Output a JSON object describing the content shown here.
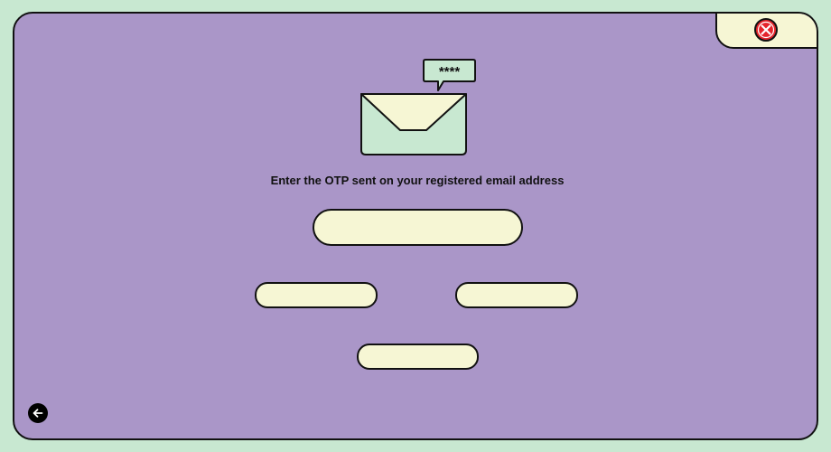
{
  "prompt": {
    "text": "Enter the OTP sent on your registered email address"
  },
  "otp_input": {
    "value": "",
    "placeholder": ""
  },
  "buttons": {
    "left_label": "",
    "right_label": "",
    "bottom_label": ""
  },
  "speech_bubble": {
    "text": "****"
  },
  "icons": {
    "close": "close-icon",
    "back": "back-arrow-icon",
    "envelope": "envelope-icon"
  },
  "colors": {
    "outer_background": "#c8e8d1",
    "panel_background": "#aa96c8",
    "field_fill": "#f6f6d4",
    "close_red": "#e5242b",
    "envelope_body": "#c8e8d1",
    "envelope_flap": "#f6f6d4"
  }
}
